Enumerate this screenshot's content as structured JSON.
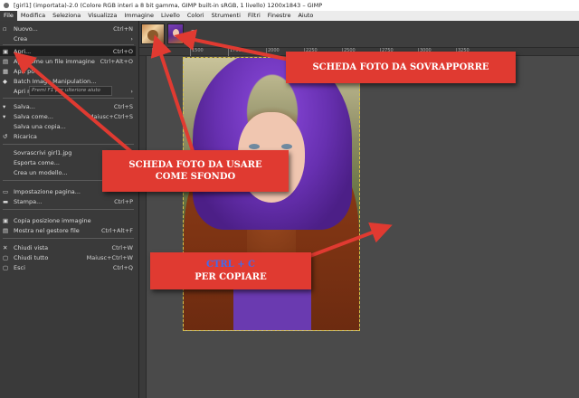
{
  "window": {
    "title": "[girl1] (importata)-2.0 (Colore RGB interi a 8 bit gamma, GIMP built-in sRGB, 1 livello) 1200x1843 – GIMP"
  },
  "menubar": [
    "File",
    "Modifica",
    "Seleziona",
    "Visualizza",
    "Immagine",
    "Livello",
    "Colori",
    "Strumenti",
    "Filtri",
    "Finestre",
    "Aiuto"
  ],
  "file_menu": {
    "items": [
      {
        "label": "Nuovo...",
        "shortcut": "Ctrl+N",
        "icon": "new-document-icon"
      },
      {
        "label": "Crea",
        "shortcut": "›",
        "icon": ""
      },
      {
        "label": "Apri...",
        "shortcut": "Ctrl+O",
        "icon": "open-icon"
      },
      {
        "label": "Apri come un file immagine",
        "shortcut": "Ctrl+Alt+O",
        "icon": "open-layers-icon"
      },
      {
        "label": "Apri po",
        "shortcut": "",
        "icon": "open-location-icon"
      },
      {
        "label": "Batch Image Manipulation...",
        "shortcut": "",
        "icon": "batch-icon"
      },
      {
        "label": "Apri recenti",
        "shortcut": "›",
        "icon": ""
      },
      {
        "label": "Salva...",
        "shortcut": "Ctrl+S",
        "icon": "save-icon"
      },
      {
        "label": "Salva come...",
        "shortcut": "Maiusc+Ctrl+S",
        "icon": "save-as-icon"
      },
      {
        "label": "Salva una copia...",
        "shortcut": "",
        "icon": ""
      },
      {
        "label": "Ricarica",
        "shortcut": "",
        "icon": "revert-icon"
      },
      {
        "label": "Sovrascrivi girl1.jpg",
        "shortcut": "",
        "icon": ""
      },
      {
        "label": "Esporta come...",
        "shortcut": "M",
        "icon": ""
      },
      {
        "label": "Crea un modello...",
        "shortcut": "",
        "icon": ""
      },
      {
        "label": "Impostazione pagina...",
        "shortcut": "",
        "icon": "page-setup-icon"
      },
      {
        "label": "Stampa...",
        "shortcut": "Ctrl+P",
        "icon": "print-icon"
      },
      {
        "label": "Copia posizione immagine",
        "shortcut": "",
        "icon": "copy-location-icon"
      },
      {
        "label": "Mostra nel gestore file",
        "shortcut": "Ctrl+Alt+F",
        "icon": "file-manager-icon"
      },
      {
        "label": "Chiudi vista",
        "shortcut": "Ctrl+W",
        "icon": "close-view-icon"
      },
      {
        "label": "Chiudi tutto",
        "shortcut": "Maiusc+Ctrl+W",
        "icon": "close-all-icon"
      },
      {
        "label": "Esci",
        "shortcut": "Ctrl+Q",
        "icon": "quit-icon"
      }
    ],
    "tooltip": "Premi F1 per ulteriore aiuto"
  },
  "ruler": {
    "marks": [
      "1250",
      "1500",
      "1750",
      "2000",
      "2250",
      "2500",
      "2750",
      "3000",
      "3250"
    ]
  },
  "annotations": {
    "top": "SCHEDA FOTO DA SOVRAPPORRE",
    "middle_line1": "SCHEDA FOTO DA USARE",
    "middle_line2": "COME SFONDO",
    "bottom_line1": "CTRL + C",
    "bottom_line2": "PER COPIARE"
  },
  "colors": {
    "annotation": "#e03a31",
    "arrow": "#e03a31",
    "keyboard_text": "#3d6cf0",
    "selection": "#d6c14a"
  }
}
